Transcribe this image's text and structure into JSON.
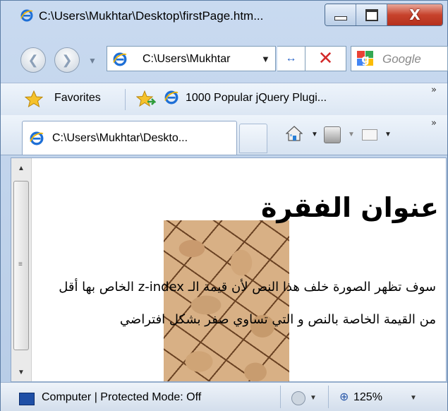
{
  "window": {
    "title": "C:\\Users\\Mukhtar\\Desktop\\firstPage.htm...",
    "close_symbol": "X"
  },
  "navigation": {
    "address": "C:\\Users\\Mukhtar",
    "search_placeholder": "Google",
    "icons": [
      "back-arrow-icon",
      "forward-arrow-icon",
      "ie-icon",
      "refresh-icon",
      "stop-icon",
      "google-icon"
    ]
  },
  "favorites_bar": {
    "label": "Favorites",
    "link": "1000 Popular jQuery Plugi..."
  },
  "tabs": [
    {
      "label": "C:\\Users\\Mukhtar\\Deskto...",
      "active": true
    }
  ],
  "page": {
    "heading": "عنوان الفقرة",
    "paragraph": "سوف تظهر الصورة خلف هذا النص لأن قيمة الـ z-index الخاص بها أقل من القيمة الخاصة بالنص و التي تساوي صفر بشكل افتراضي"
  },
  "status_bar": {
    "zone": "Computer | Protected Mode: Off",
    "zoom": "125%"
  },
  "colors": {
    "chrome": "#c9daf0",
    "close_button": "#c7432d",
    "image_texture": "#d8b085"
  }
}
